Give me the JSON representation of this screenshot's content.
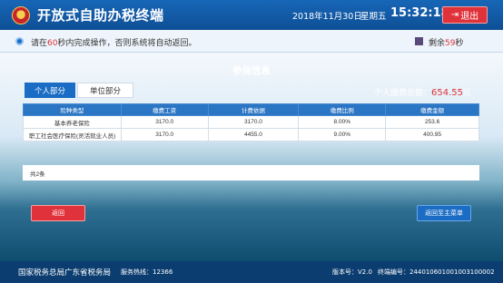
{
  "header": {
    "title": "开放式自助办税终端",
    "date": "2018年11月30日",
    "weekday": "星期五",
    "time": "15:32:18",
    "exit_label": "退出",
    "exit_icon": "exit-icon"
  },
  "notice": {
    "prefix": "请在",
    "seconds": "60",
    "suffix": "秒内完成操作，否则系统将自动返回。",
    "countdown_prefix": "剩余",
    "countdown_seconds": "59",
    "countdown_suffix": "秒"
  },
  "main": {
    "title": "参保信息",
    "tabs": [
      {
        "label": "个人部分",
        "active": true
      },
      {
        "label": "单位部分",
        "active": false
      }
    ],
    "total_label": "个人缴费总额：",
    "total_amount": "654.55",
    "total_unit": "元"
  },
  "table": {
    "headers": [
      "险种类型",
      "缴费工资",
      "计费依据",
      "缴费比例",
      "缴费金额"
    ],
    "rows": [
      [
        "基本养老保险",
        "3170.0",
        "3170.0",
        "8.00%",
        "253.6"
      ],
      [
        "职工社会医疗保险(灵活就业人员)",
        "3170.0",
        "4455.0",
        "9.00%",
        "400.95"
      ]
    ]
  },
  "pager": {
    "text": "共2条"
  },
  "buttons": {
    "back": "返回",
    "home": "返回至主菜单"
  },
  "footer": {
    "org": "国家税务总局广东省税务局",
    "hotline": "服务热线：12366",
    "version": "版本号：V2.0",
    "terminal": "终端编号：244010601001003100002"
  }
}
